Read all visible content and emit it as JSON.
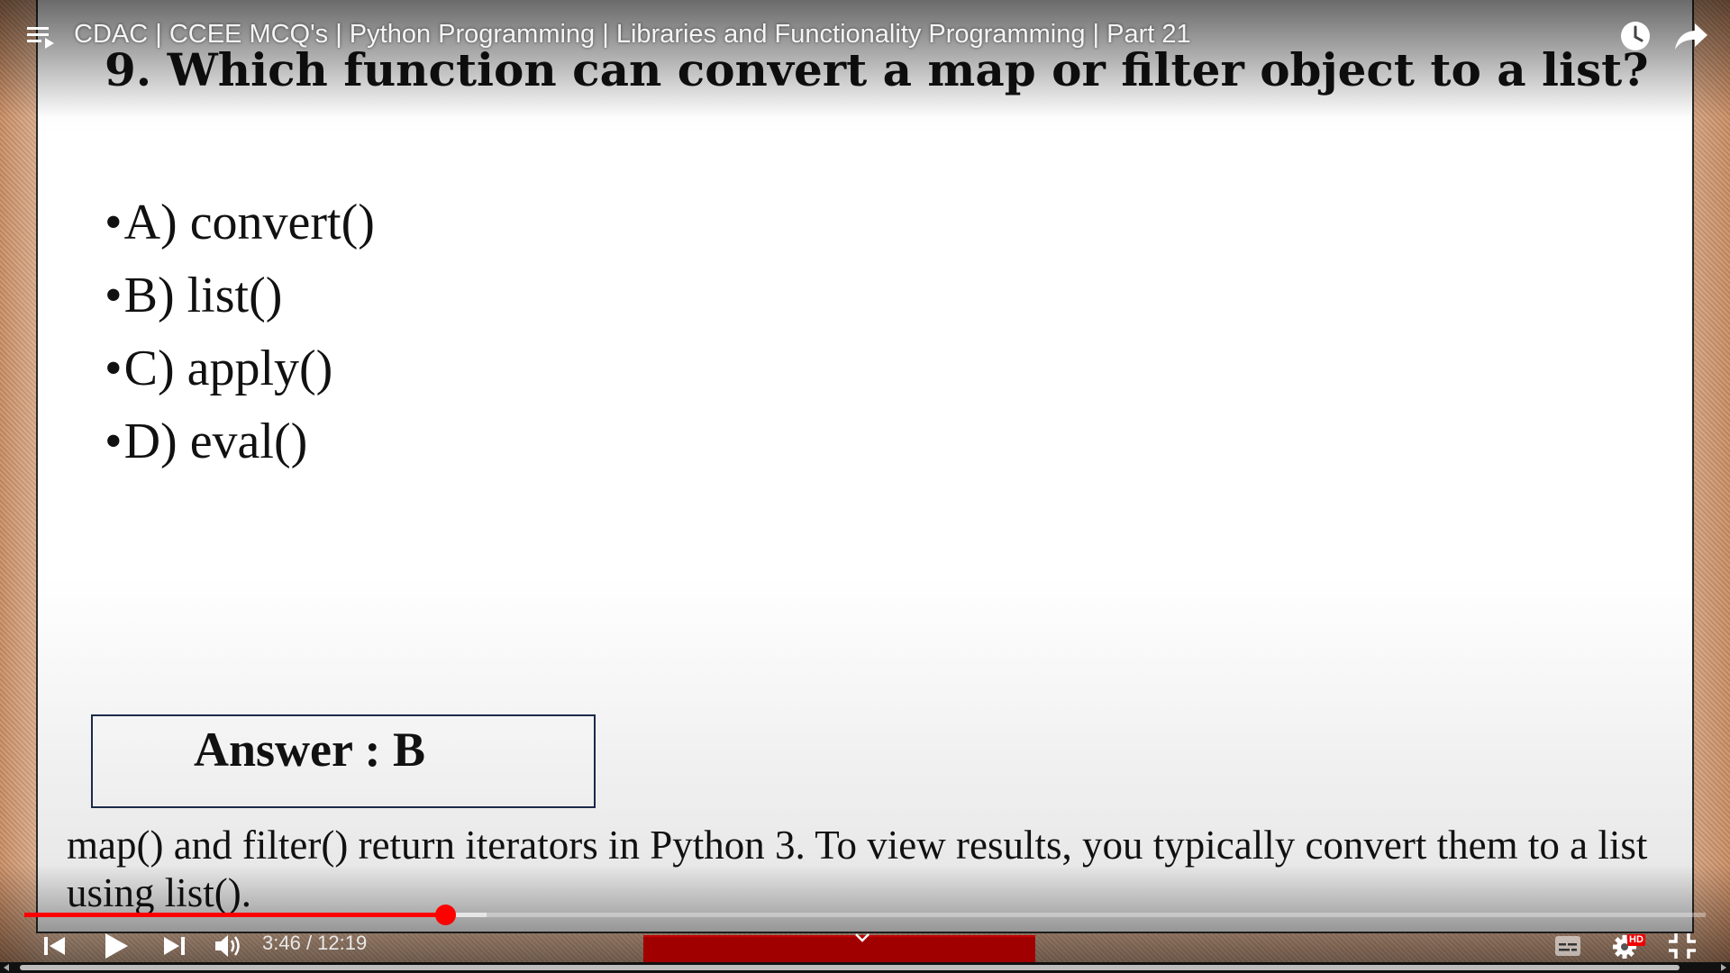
{
  "video": {
    "title": "CDAC | CCEE MCQ's | Python Programming | Libraries and Functionality Programming | Part 21",
    "current_time": "3:46",
    "time_separator": " / ",
    "duration": "12:19",
    "played_fraction": 0.25,
    "buffered_fraction": 0.275,
    "quality_badge": "HD",
    "accent_color": "#ff0000"
  },
  "slide": {
    "question": "9. Which function can convert a map or filter object to a list?",
    "options": [
      {
        "bullet": "•",
        "text": "A) convert()"
      },
      {
        "bullet": "•",
        "text": "B) list()"
      },
      {
        "bullet": "•",
        "text": "C) apply()"
      },
      {
        "bullet": "•",
        "text": "D) eval()"
      }
    ],
    "answer": "Answer : B",
    "explanation": "map() and filter() return iterators in Python 3. To view results, you typically convert them to a list using list()."
  },
  "icons": {
    "top_left": "playlist-icon",
    "top_right": [
      "watch-later-icon",
      "share-icon"
    ],
    "controls": [
      "previous-icon",
      "play-icon",
      "next-icon",
      "volume-icon",
      "subtitles-icon",
      "settings-icon",
      "exit-fullscreen-icon"
    ]
  }
}
